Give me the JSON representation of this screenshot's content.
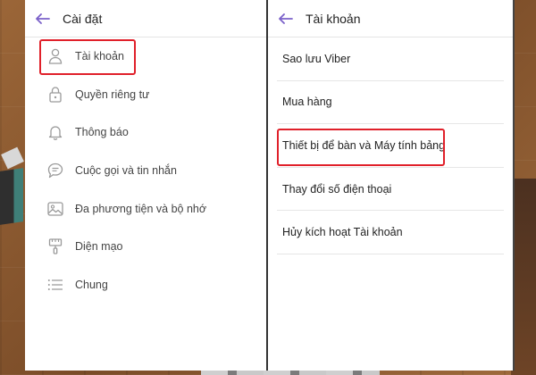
{
  "left_pane": {
    "title": "Cài đặt",
    "items": [
      {
        "label": "Tài khoản",
        "icon": "user-icon"
      },
      {
        "label": "Quyền riêng tư",
        "icon": "lock-icon"
      },
      {
        "label": "Thông báo",
        "icon": "bell-icon"
      },
      {
        "label": "Cuộc gọi và tin nhắn",
        "icon": "chat-icon"
      },
      {
        "label": "Đa phương tiện và bộ nhớ",
        "icon": "image-icon"
      },
      {
        "label": "Diện mạo",
        "icon": "paintbrush-icon"
      },
      {
        "label": "Chung",
        "icon": "list-icon"
      }
    ]
  },
  "right_pane": {
    "title": "Tài khoản",
    "items": [
      {
        "label": "Sao lưu Viber"
      },
      {
        "label": "Mua hàng"
      },
      {
        "label": "Thiết bị để bàn và Máy tính bảng"
      },
      {
        "label": "Thay đổi số điện thoại"
      },
      {
        "label": "Hủy kích hoạt Tài khoản"
      }
    ]
  },
  "colors": {
    "accent": "#7b61c9",
    "highlight": "#e0202a",
    "icon_gray": "#9a9a9a"
  }
}
